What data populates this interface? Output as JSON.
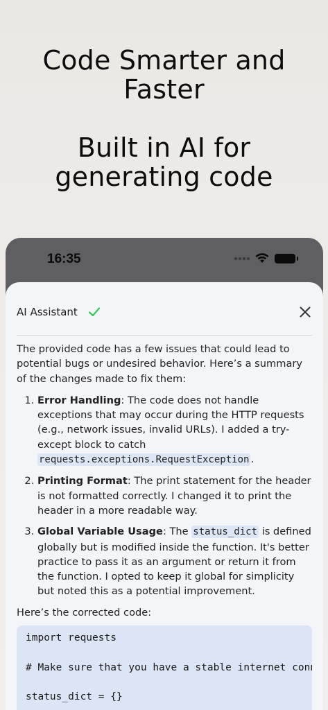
{
  "promo": {
    "headline": "Code Smarter and Faster",
    "subheadline": "Built in AI for generating code"
  },
  "status_bar": {
    "time": "16:35"
  },
  "assistant": {
    "title": "AI Assistant",
    "intro": "The provided code has a few issues that could lead to potential bugs or undesired behavior. Here’s a summary of the changes made to fix them:",
    "items": [
      {
        "heading": "Error Handling",
        "text": ": The code does not handle exceptions that may occur during the HTTP requests (e.g., network issues, invalid URLs). I added a try-except block to catch ",
        "code": "requests.exceptions.RequestException",
        "after": "."
      },
      {
        "heading": "Printing Format",
        "text": ": The print statement for the header is not formatted correctly. I changed it to print the header in a more readable way."
      },
      {
        "heading": "Global Variable Usage",
        "text_before": ": The ",
        "code": "status_dict",
        "text": " is defined globally but is modified inside the function. It's better practice to pass it as an argument or return it from the function. I opted to keep it global for simplicity but noted this as a potential improvement."
      }
    ],
    "corrected_label": "Here’s the corrected code:",
    "code_lines": [
      "import requests",
      "",
      "# Make sure that you have a stable internet connection",
      "",
      "status_dict = {}"
    ]
  }
}
